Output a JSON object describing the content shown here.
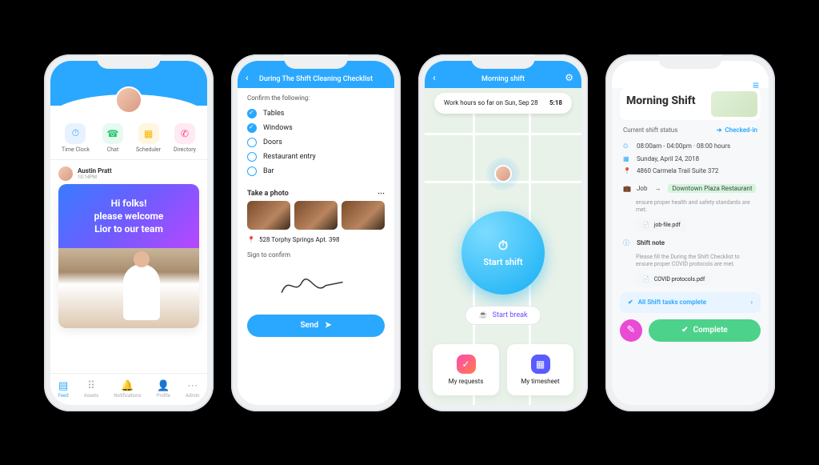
{
  "screens": {
    "feed": {
      "icons": [
        {
          "label": "Time Clock",
          "glyph": "⏱"
        },
        {
          "label": "Chat",
          "glyph": "☎"
        },
        {
          "label": "Scheduler",
          "glyph": "▦"
        },
        {
          "label": "Directory",
          "glyph": "✆"
        }
      ],
      "post": {
        "author": "Austin Pratt",
        "time": "10:14PM",
        "line1": "Hi folks!",
        "line2": "please welcome",
        "line3": "Lior to our team"
      },
      "tabs": [
        {
          "label": "Feed",
          "glyph": "▤"
        },
        {
          "label": "Assets",
          "glyph": "⠿"
        },
        {
          "label": "Notifications",
          "glyph": "🔔"
        },
        {
          "label": "Profile",
          "glyph": "👤"
        },
        {
          "label": "Admin",
          "glyph": "⋯"
        }
      ]
    },
    "checklist": {
      "title": "During The Shift Cleaning Checklist",
      "confirm_label": "Confirm the following:",
      "items": [
        {
          "label": "Tables",
          "checked": true
        },
        {
          "label": "Windows",
          "checked": true
        },
        {
          "label": "Doors",
          "checked": false
        },
        {
          "label": "Restaurant entry",
          "checked": false
        },
        {
          "label": "Bar",
          "checked": false
        }
      ],
      "photo_label": "Take a photo",
      "address": "528 Torphy Springs Apt. 398",
      "sign_label": "Sign to confirm",
      "send_label": "Send"
    },
    "shift": {
      "title": "Morning shift",
      "pill_label": "Work hours so far on Sun, Sep 28",
      "pill_value": "5:18",
      "start_label": "Start shift",
      "break_label": "Start break",
      "card1": "My requests",
      "card2": "My timesheet"
    },
    "detail": {
      "title": "Morning Shift",
      "status_label": "Current shift status",
      "status_value": "Checked-in",
      "time_row": "08:00am - 04:00pm · 08:00 hours",
      "date_row": "Sunday, April 24, 2018",
      "addr_row": "4860 Carmela Trail Suite 372",
      "job_label": "Job",
      "job_value": "Downtown Plaza Restaurant",
      "job_note": "ensure proper health and safety standards are met.",
      "file1": "job-file.pdf",
      "shiftnote_title": "Shift note",
      "shiftnote_body": "Please fill the During the Shift Checklist to ensure proper COVID protocols are met.",
      "file2": "COVID protocols.pdf",
      "tasks_label": "All Shift tasks complete",
      "complete_label": "Complete"
    }
  }
}
